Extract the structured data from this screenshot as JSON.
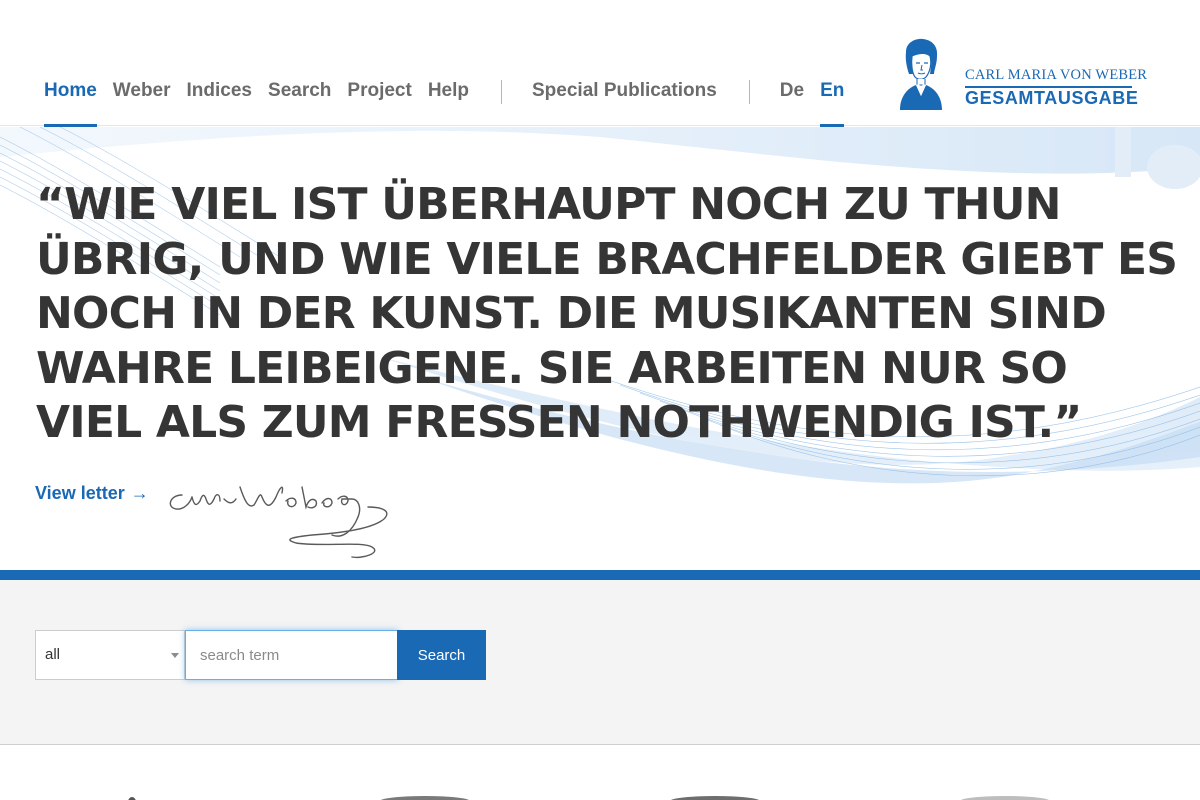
{
  "nav": {
    "items": [
      "Home",
      "Weber",
      "Indices",
      "Search",
      "Project",
      "Help"
    ],
    "active": "Home",
    "special": "Special Publications",
    "languages": [
      "De",
      "En"
    ],
    "active_language": "En"
  },
  "logo": {
    "line1": "CARL MARIA VON WEBER",
    "line2": "GESAMTAUSGABE"
  },
  "hero": {
    "quote": "“WIE VIEL IST ÜBERHAUPT NOCH ZU THUN ÜBRIG, UND WIE VIELE BRACHFELDER GIEBT ES NOCH IN DER KUNST. DIE MUSIKANTEN SIND WAHRE LEIBEIGENE. SIE ARBEITEN NUR SO VIEL ALS ZUM FRESSEN NOTHWENDIG IST.”",
    "view_letter": "View letter",
    "arrow": "→"
  },
  "search": {
    "select_value": "all",
    "placeholder": "search term",
    "button": "Search"
  },
  "colors": {
    "accent": "#1a69b5",
    "text": "#353535",
    "nav_text": "#6b6b6b",
    "band": "#f4f4f4"
  },
  "icons": {
    "logo": "weber-portrait-icon",
    "arrow": "arrow-right-icon",
    "caret": "caret-down-icon",
    "signature": "signature-image"
  }
}
